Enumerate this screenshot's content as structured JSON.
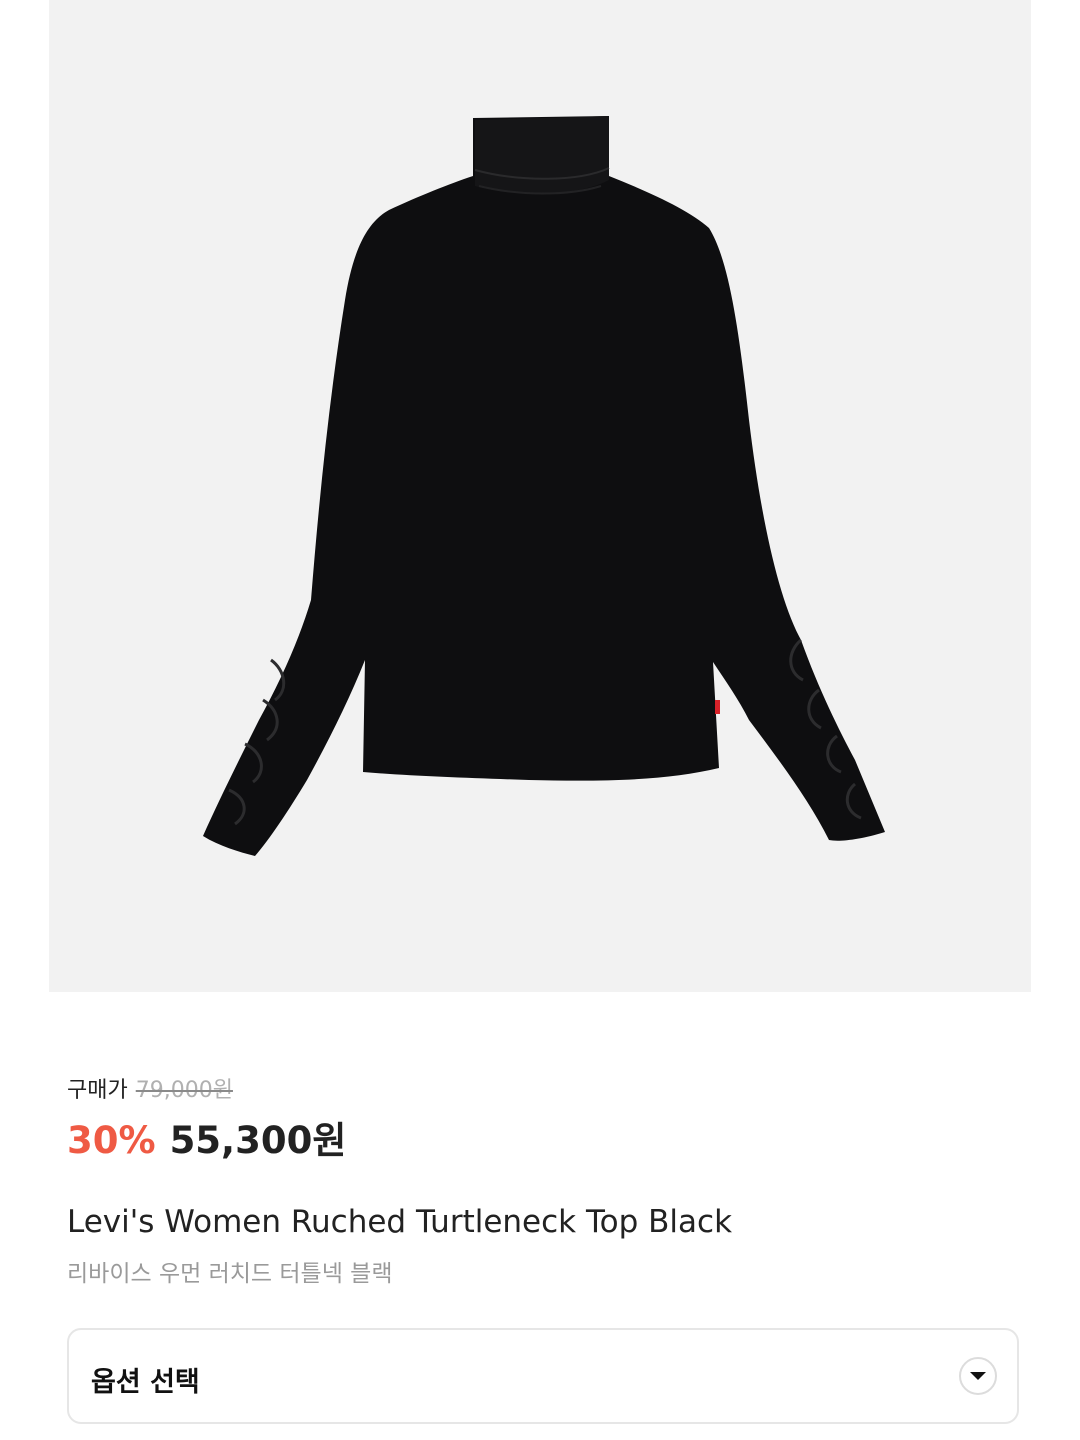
{
  "product": {
    "image_alt": "black turtleneck top",
    "price_label": "구매가",
    "original_price": "79,000원",
    "discount": "30%",
    "sale_price": "55,300원",
    "title_en": "Levi's Women Ruched Turtleneck Top Black",
    "title_ko": "리바이스 우먼 러치드 터틀넥 블랙"
  },
  "option": {
    "label": "옵션 선택",
    "icon": "chevron-down-icon"
  },
  "colors": {
    "image_bg": "#f2f2f2",
    "discount": "#ef5a44",
    "text": "#222222",
    "muted": "#9a9a9a",
    "garment": "#0e0e10",
    "tag": "#d8222a"
  }
}
